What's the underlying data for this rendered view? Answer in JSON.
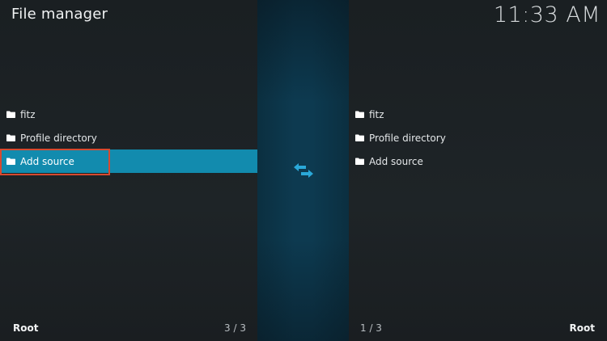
{
  "header": {
    "title": "File manager",
    "clock": "11:33 AM"
  },
  "left_pane": {
    "items": [
      {
        "label": "fitz",
        "icon": "folder-icon"
      },
      {
        "label": "Profile directory",
        "icon": "folder-icon"
      },
      {
        "label": "Add source",
        "icon": "folder-icon",
        "selected": true
      }
    ],
    "footer_label": "Root",
    "footer_count": "3 / 3"
  },
  "right_pane": {
    "items": [
      {
        "label": "fitz",
        "icon": "folder-icon"
      },
      {
        "label": "Profile directory",
        "icon": "folder-icon"
      },
      {
        "label": "Add source",
        "icon": "folder-icon"
      }
    ],
    "footer_label": "Root",
    "footer_count": "1 / 3"
  },
  "center": {
    "icon": "swap-arrows-icon"
  },
  "colors": {
    "accent": "#128bae",
    "highlight_border": "#d8492f",
    "swap_icon": "#2aa8d8",
    "background": "#1c2124"
  }
}
